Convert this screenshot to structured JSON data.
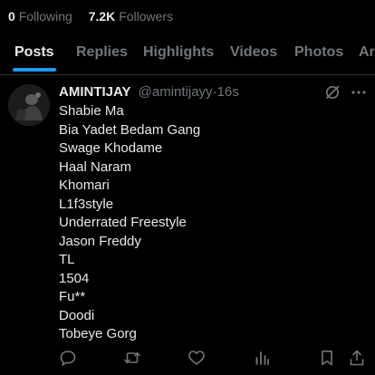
{
  "profile_stats": {
    "following_count": "0",
    "following_label": "Following",
    "followers_count": "7.2K",
    "followers_label": "Followers"
  },
  "tabs": [
    {
      "label": "Posts",
      "active": true
    },
    {
      "label": "Replies",
      "active": false
    },
    {
      "label": "Highlights",
      "active": false
    },
    {
      "label": "Videos",
      "active": false
    },
    {
      "label": "Photos",
      "active": false
    },
    {
      "label": "Ar",
      "active": false
    }
  ],
  "post": {
    "author_name": "AMINTIJAY",
    "handle": "@amintijayy",
    "separator": "·",
    "time": "16s",
    "lines": [
      "Shabie Ma",
      "Bia Yadet Bedam Gang",
      "Swage Khodame",
      "Haal Naram",
      "Khomari",
      "L1f3style",
      "Underrated Freestyle",
      "Jason Freddy",
      "TL",
      "1504",
      "Fu**",
      "Doodi",
      "Tobeye Gorg"
    ],
    "icons": {
      "grok": "grok-icon",
      "more": "more-icon"
    }
  },
  "actions": [
    {
      "name": "reply-icon"
    },
    {
      "name": "repost-icon"
    },
    {
      "name": "like-icon"
    },
    {
      "name": "views-icon"
    },
    {
      "name": "bookmark-icon"
    },
    {
      "name": "share-icon"
    }
  ],
  "colors": {
    "background": "#000000",
    "text": "#e7e9ea",
    "muted": "#71767b",
    "accent": "#1d9bf0",
    "divider": "#2f3336"
  }
}
